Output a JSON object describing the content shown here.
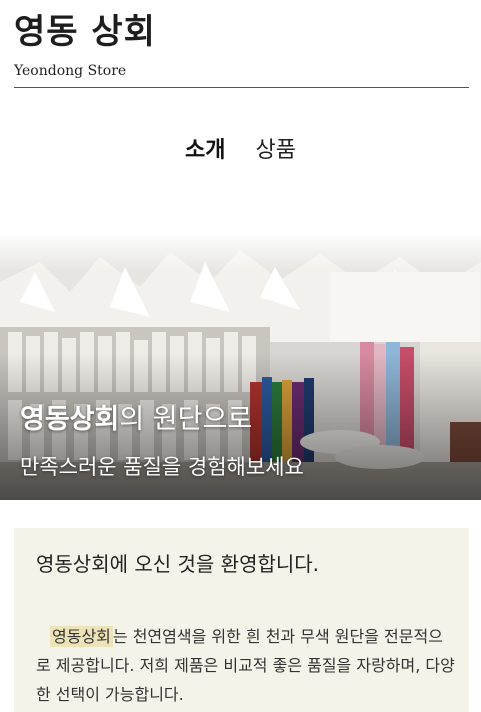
{
  "header": {
    "title": "영동 상회",
    "subtitle": "Yeondong Store"
  },
  "nav": {
    "tabs": [
      {
        "label": "소개",
        "active": true
      },
      {
        "label": "상품",
        "active": false
      }
    ]
  },
  "hero": {
    "line1_bold": "영동상회",
    "line1_rest": "의 원단으로",
    "line2": "만족스러운 품질을 경험해보세요"
  },
  "welcome": {
    "title": "영동상회에 오신 것을 환영합니다.",
    "body_highlight": "영동상회",
    "body_rest": "는 천연염색을 위한 흰 천과 무색 원단을 전문적으로 제공합니다. 저희 제품은 비교적 좋은 품질을 자랑하며, 다양한 선택이 가능합니다."
  },
  "colors": {
    "background": "#ffffff",
    "panel": "#f4f3ea",
    "highlight": "#ece4b8"
  }
}
